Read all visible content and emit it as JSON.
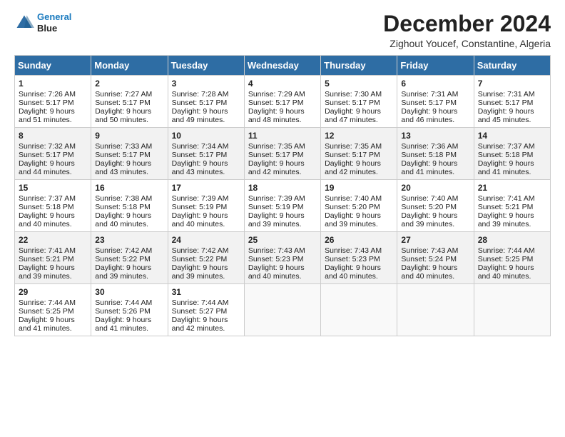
{
  "logo": {
    "line1": "General",
    "line2": "Blue"
  },
  "title": "December 2024",
  "subtitle": "Zighout Youcef, Constantine, Algeria",
  "headers": [
    "Sunday",
    "Monday",
    "Tuesday",
    "Wednesday",
    "Thursday",
    "Friday",
    "Saturday"
  ],
  "weeks": [
    [
      {
        "day": "1",
        "sunrise": "7:26 AM",
        "sunset": "5:17 PM",
        "daylight": "9 hours and 51 minutes."
      },
      {
        "day": "2",
        "sunrise": "7:27 AM",
        "sunset": "5:17 PM",
        "daylight": "9 hours and 50 minutes."
      },
      {
        "day": "3",
        "sunrise": "7:28 AM",
        "sunset": "5:17 PM",
        "daylight": "9 hours and 49 minutes."
      },
      {
        "day": "4",
        "sunrise": "7:29 AM",
        "sunset": "5:17 PM",
        "daylight": "9 hours and 48 minutes."
      },
      {
        "day": "5",
        "sunrise": "7:30 AM",
        "sunset": "5:17 PM",
        "daylight": "9 hours and 47 minutes."
      },
      {
        "day": "6",
        "sunrise": "7:31 AM",
        "sunset": "5:17 PM",
        "daylight": "9 hours and 46 minutes."
      },
      {
        "day": "7",
        "sunrise": "7:31 AM",
        "sunset": "5:17 PM",
        "daylight": "9 hours and 45 minutes."
      }
    ],
    [
      {
        "day": "8",
        "sunrise": "7:32 AM",
        "sunset": "5:17 PM",
        "daylight": "9 hours and 44 minutes."
      },
      {
        "day": "9",
        "sunrise": "7:33 AM",
        "sunset": "5:17 PM",
        "daylight": "9 hours and 43 minutes."
      },
      {
        "day": "10",
        "sunrise": "7:34 AM",
        "sunset": "5:17 PM",
        "daylight": "9 hours and 43 minutes."
      },
      {
        "day": "11",
        "sunrise": "7:35 AM",
        "sunset": "5:17 PM",
        "daylight": "9 hours and 42 minutes."
      },
      {
        "day": "12",
        "sunrise": "7:35 AM",
        "sunset": "5:17 PM",
        "daylight": "9 hours and 42 minutes."
      },
      {
        "day": "13",
        "sunrise": "7:36 AM",
        "sunset": "5:18 PM",
        "daylight": "9 hours and 41 minutes."
      },
      {
        "day": "14",
        "sunrise": "7:37 AM",
        "sunset": "5:18 PM",
        "daylight": "9 hours and 41 minutes."
      }
    ],
    [
      {
        "day": "15",
        "sunrise": "7:37 AM",
        "sunset": "5:18 PM",
        "daylight": "9 hours and 40 minutes."
      },
      {
        "day": "16",
        "sunrise": "7:38 AM",
        "sunset": "5:18 PM",
        "daylight": "9 hours and 40 minutes."
      },
      {
        "day": "17",
        "sunrise": "7:39 AM",
        "sunset": "5:19 PM",
        "daylight": "9 hours and 40 minutes."
      },
      {
        "day": "18",
        "sunrise": "7:39 AM",
        "sunset": "5:19 PM",
        "daylight": "9 hours and 39 minutes."
      },
      {
        "day": "19",
        "sunrise": "7:40 AM",
        "sunset": "5:20 PM",
        "daylight": "9 hours and 39 minutes."
      },
      {
        "day": "20",
        "sunrise": "7:40 AM",
        "sunset": "5:20 PM",
        "daylight": "9 hours and 39 minutes."
      },
      {
        "day": "21",
        "sunrise": "7:41 AM",
        "sunset": "5:21 PM",
        "daylight": "9 hours and 39 minutes."
      }
    ],
    [
      {
        "day": "22",
        "sunrise": "7:41 AM",
        "sunset": "5:21 PM",
        "daylight": "9 hours and 39 minutes."
      },
      {
        "day": "23",
        "sunrise": "7:42 AM",
        "sunset": "5:22 PM",
        "daylight": "9 hours and 39 minutes."
      },
      {
        "day": "24",
        "sunrise": "7:42 AM",
        "sunset": "5:22 PM",
        "daylight": "9 hours and 39 minutes."
      },
      {
        "day": "25",
        "sunrise": "7:43 AM",
        "sunset": "5:23 PM",
        "daylight": "9 hours and 40 minutes."
      },
      {
        "day": "26",
        "sunrise": "7:43 AM",
        "sunset": "5:23 PM",
        "daylight": "9 hours and 40 minutes."
      },
      {
        "day": "27",
        "sunrise": "7:43 AM",
        "sunset": "5:24 PM",
        "daylight": "9 hours and 40 minutes."
      },
      {
        "day": "28",
        "sunrise": "7:44 AM",
        "sunset": "5:25 PM",
        "daylight": "9 hours and 40 minutes."
      }
    ],
    [
      {
        "day": "29",
        "sunrise": "7:44 AM",
        "sunset": "5:25 PM",
        "daylight": "9 hours and 41 minutes."
      },
      {
        "day": "30",
        "sunrise": "7:44 AM",
        "sunset": "5:26 PM",
        "daylight": "9 hours and 41 minutes."
      },
      {
        "day": "31",
        "sunrise": "7:44 AM",
        "sunset": "5:27 PM",
        "daylight": "9 hours and 42 minutes."
      },
      null,
      null,
      null,
      null
    ]
  ]
}
